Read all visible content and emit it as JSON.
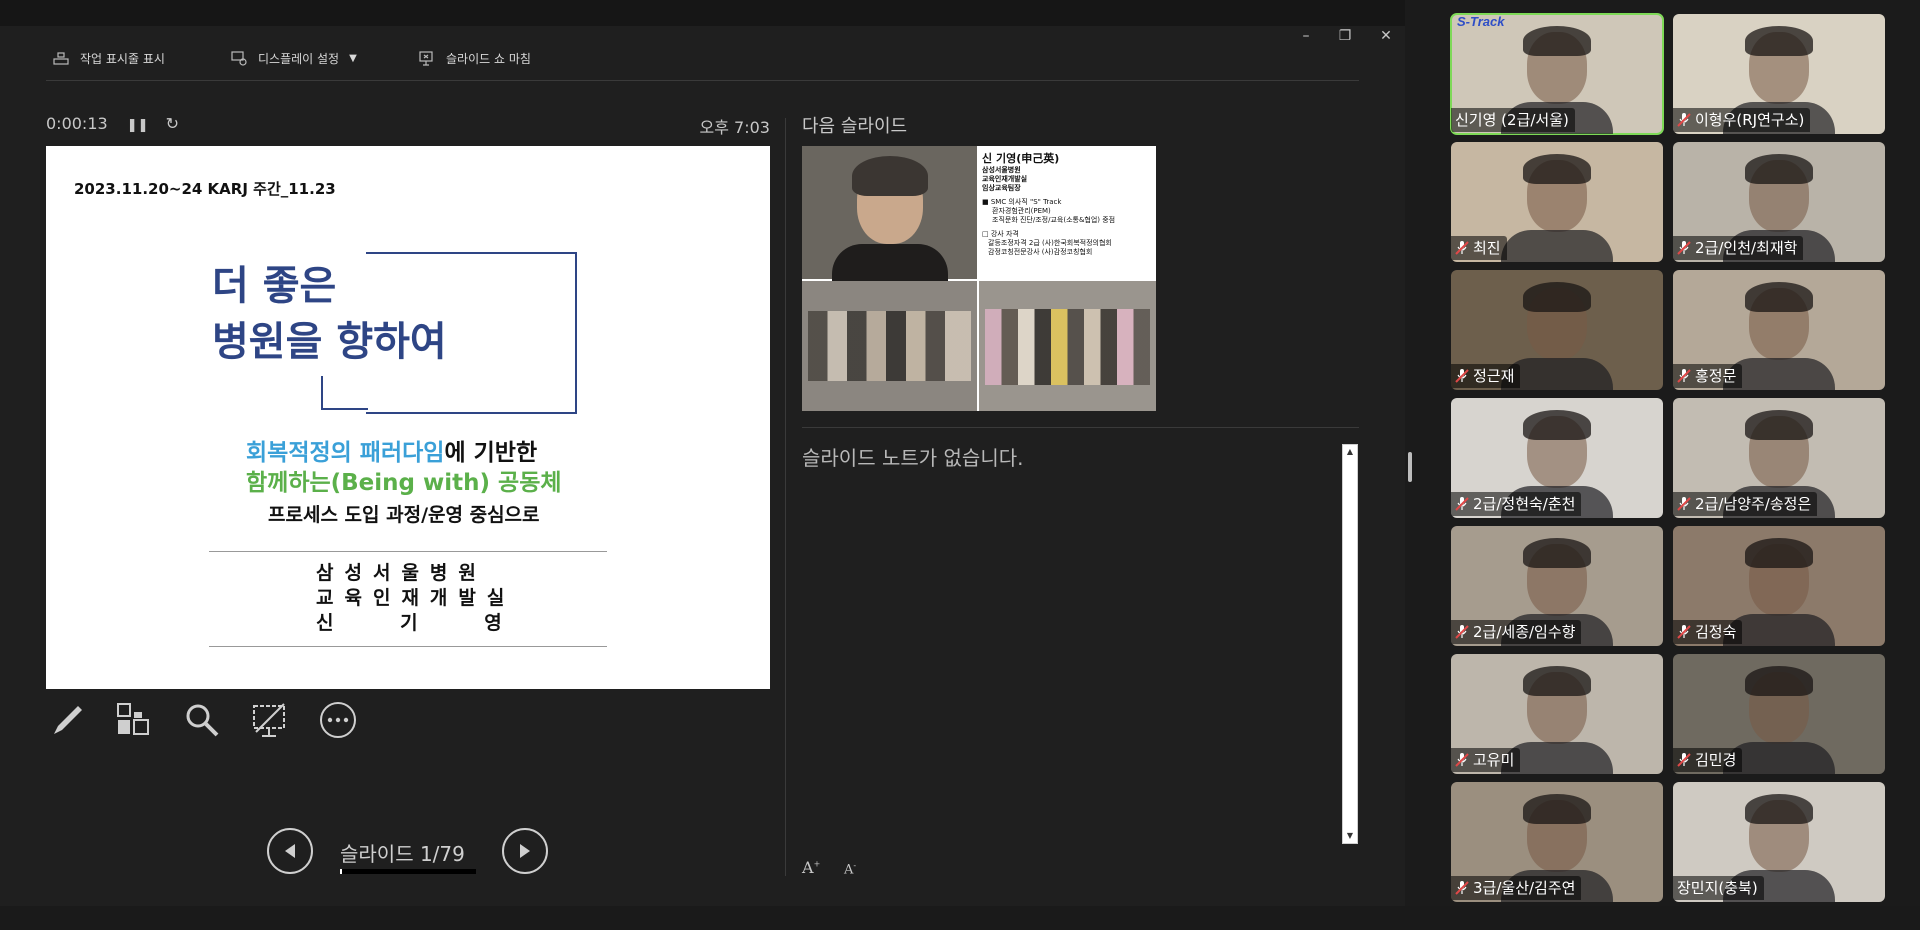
{
  "toolbar": {
    "taskbar_label": "작업 표시줄 표시",
    "display_label": "디스플레이 설정",
    "end_label": "슬라이드 쇼 마침"
  },
  "status": {
    "elapsed": "0:00:13",
    "clock": "오후 7:03"
  },
  "slide": {
    "date": "2023.11.20~24 KARJ 주간_11.23",
    "title_line1": "더 좋은",
    "title_line2": "병원을 향하여",
    "sub1_blue": "회복적정의 패러다임",
    "sub1_rest": "에 기반한",
    "sub2": "함께하는(Being with) 공동체",
    "sub3": "프로세스 도입 과정/운영 중심으로",
    "org1": "삼성서울병원",
    "org2": "교육인재개발실",
    "org3": "신 기 영"
  },
  "nav": {
    "slide_count": "슬라이드 1/79",
    "progress_fraction": 0.0127
  },
  "next_slide": {
    "label": "다음 슬라이드",
    "name": "신 기영(申己英)",
    "lines": [
      "삼성서울병원",
      "교육인재개발실",
      "임상교육팀장"
    ],
    "list1_title": "■ SMC 의사직 \"S\" Track",
    "list1_items": [
      "환자경험관리(PEM)",
      "조직문화 진단/조정/교육(소통&협업) 중점"
    ],
    "list2_title": "□ 강사 자격",
    "list2_items": [
      "갈등조정자격 2급 (사)한국회복적정의협회",
      "감정코칭전문강사 (사)감정코칭협회"
    ]
  },
  "notes": {
    "text": "슬라이드 노트가 없습니다."
  },
  "participants": [
    {
      "name": "신기영 (2급/서울)",
      "muted": false,
      "active": true,
      "logo": "S-Track",
      "bg": "#cfc7b8"
    },
    {
      "name": "이형우(RJ연구소)",
      "muted": true,
      "active": false,
      "bg": "#d9d2c3"
    },
    {
      "name": "최진",
      "muted": true,
      "active": false,
      "bg": "#c6b7a2"
    },
    {
      "name": "2급/인천/최재학",
      "muted": true,
      "active": false,
      "bg": "#b9b3a8"
    },
    {
      "name": "정근재",
      "muted": true,
      "active": false,
      "bg": "#6d5f4c"
    },
    {
      "name": "홍정문",
      "muted": true,
      "active": false,
      "bg": "#b4a898"
    },
    {
      "name": "2급/정현숙/춘천",
      "muted": true,
      "active": false,
      "bg": "#d7d4cf"
    },
    {
      "name": "2급/남양주/송정은",
      "muted": true,
      "active": false,
      "bg": "#c2bcb2"
    },
    {
      "name": "2급/세종/임수향",
      "muted": true,
      "active": false,
      "bg": "#a69c8e"
    },
    {
      "name": "김정숙",
      "muted": true,
      "active": false,
      "bg": "#8c7a6a"
    },
    {
      "name": "고유미",
      "muted": true,
      "active": false,
      "bg": "#bdb6ab"
    },
    {
      "name": "김민경",
      "muted": true,
      "active": false,
      "bg": "#6f6a60"
    },
    {
      "name": "3급/울산/김주연",
      "muted": true,
      "active": false,
      "bg": "#9b8f7f"
    },
    {
      "name": "장민지(충북)",
      "muted": false,
      "active": false,
      "bg": "#cfcac2"
    }
  ],
  "colors": {
    "accent_green": "#7ed957",
    "title_blue": "#2e4585",
    "muted_red": "#e04848"
  }
}
